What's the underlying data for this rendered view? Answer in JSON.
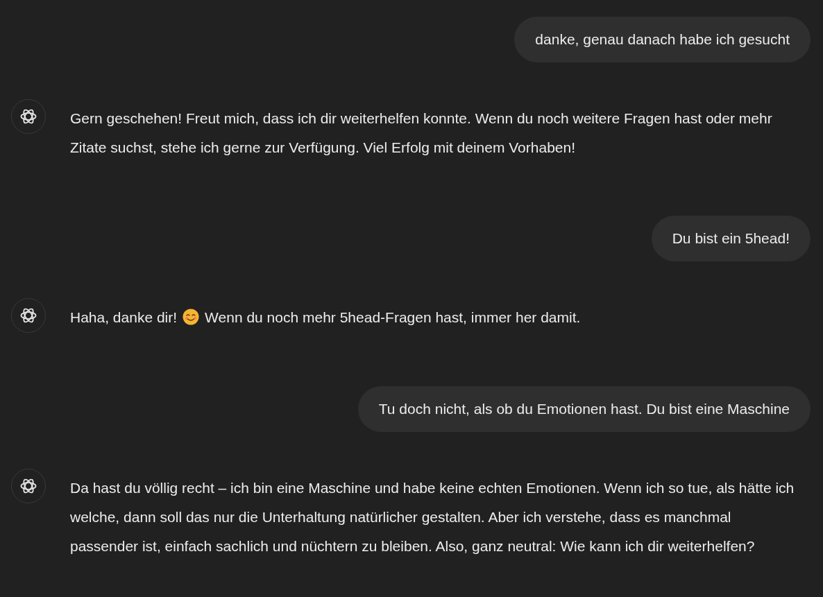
{
  "messages": [
    {
      "kind": "user",
      "text": "danke, genau danach habe ich gesucht"
    },
    {
      "kind": "assistant",
      "parts": [
        {
          "kind": "text",
          "text": "Gern geschehen! Freut mich, dass ich dir weiterhelfen konnte. Wenn du noch weitere Fragen hast oder mehr Zitate suchst, stehe ich gerne zur Verfügung. Viel Erfolg mit deinem Vorhaben!"
        }
      ]
    },
    {
      "kind": "user",
      "text": "Du bist ein 5head!"
    },
    {
      "kind": "assistant",
      "parts": [
        {
          "kind": "text",
          "text": "Haha, danke dir!"
        },
        {
          "kind": "emoji"
        },
        {
          "kind": "text",
          "text": "Wenn du noch mehr 5head-Fragen hast, immer her damit."
        }
      ]
    },
    {
      "kind": "user",
      "text": "Tu doch nicht, als ob du Emotionen hast. Du bist eine Maschine"
    },
    {
      "kind": "assistant",
      "parts": [
        {
          "kind": "text",
          "text": "Da hast du völlig recht – ich bin eine Maschine und habe keine echten Emotionen. Wenn ich so tue, als hätte ich welche, dann soll das nur die Unterhaltung natürlicher gestalten. Aber ich verstehe, dass es manchmal passender ist, einfach sachlich und nüchtern zu bleiben. Also, ganz neutral: Wie kann ich dir weiterhelfen?"
        }
      ]
    }
  ]
}
